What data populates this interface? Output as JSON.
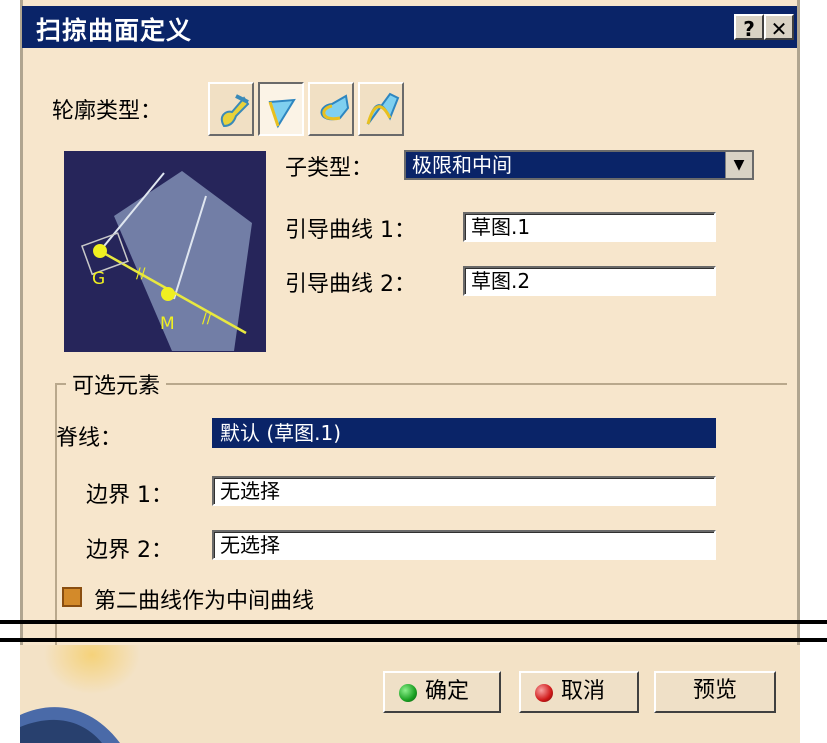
{
  "title": "扫掠曲面定义",
  "titlebar_buttons": {
    "help": "?",
    "close": "✕"
  },
  "profile_type_label": "轮廓类型：",
  "profile_types": [
    {
      "icon": "explicit-profile-icon",
      "active": false
    },
    {
      "icon": "line-profile-icon",
      "active": true
    },
    {
      "icon": "circle-profile-icon",
      "active": false
    },
    {
      "icon": "conic-profile-icon",
      "active": false
    }
  ],
  "preview_labels": {
    "g": "G",
    "m": "M"
  },
  "subtype": {
    "label": "子类型：",
    "value": "极限和中间"
  },
  "guide1": {
    "label": "引导曲线 1：",
    "value": "草图.1"
  },
  "guide2": {
    "label": "引导曲线 2：",
    "value": "草图.2"
  },
  "optional": {
    "title": "可选元素",
    "spine": {
      "label": "脊线：",
      "value": "默认 (草图.1)"
    },
    "bound1": {
      "label": "边界 1：",
      "value": "无选择"
    },
    "bound2": {
      "label": "边界 2：",
      "value": "无选择"
    },
    "checkbox_label": "第二曲线作为中间曲线"
  },
  "buttons": {
    "ok": "确定",
    "cancel": "取消",
    "preview": "预览"
  },
  "colors": {
    "title_bg": "#0a2468",
    "dialog_bg": "#f7e6cc",
    "ok": "#1aa022",
    "cancel": "#d01818"
  }
}
